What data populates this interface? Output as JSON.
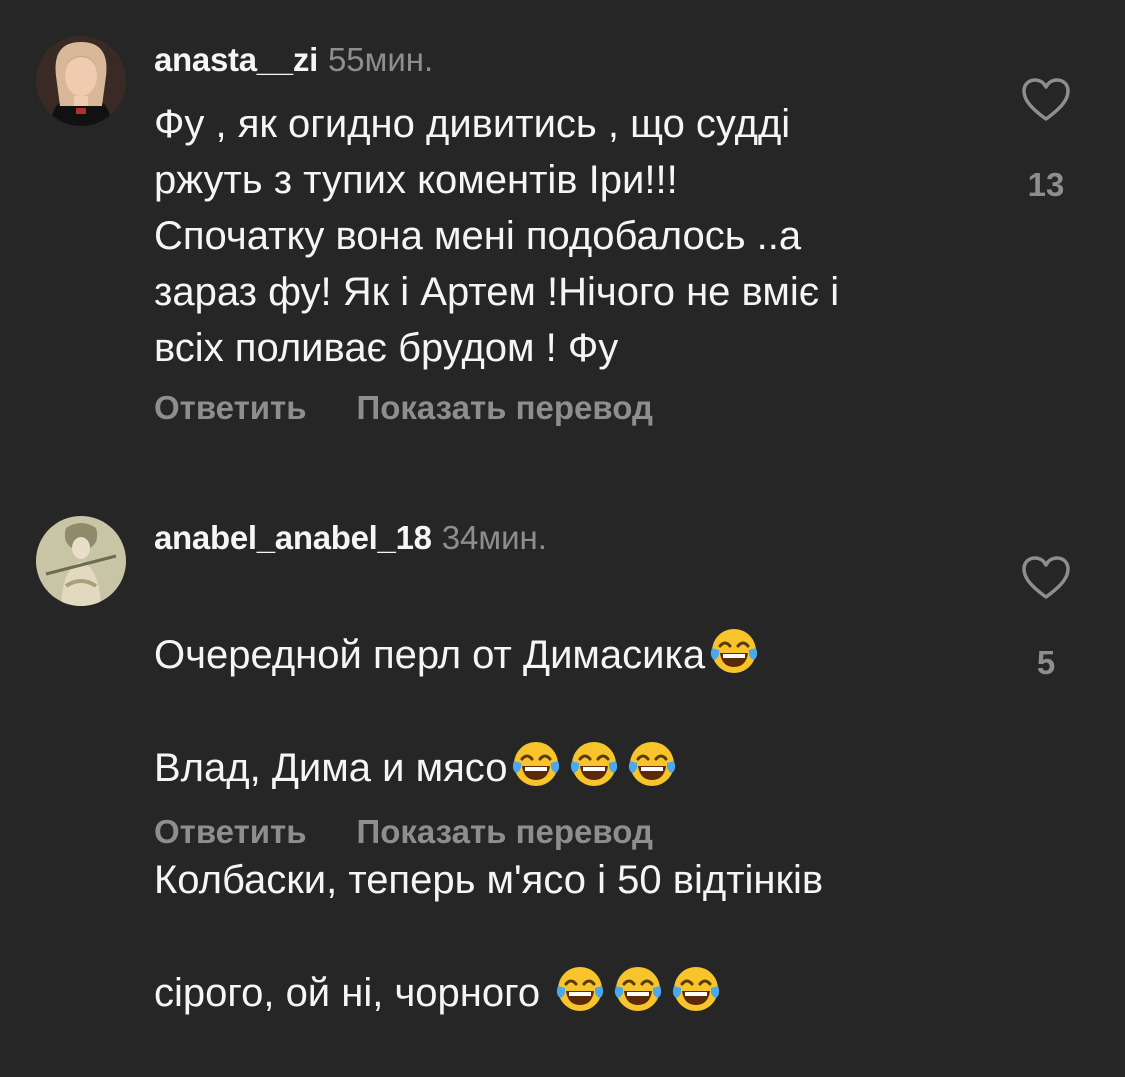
{
  "comments": [
    {
      "username": "anasta__zi",
      "time": "55мин.",
      "text": "Фу , як огидно  дивитись , що судді\nржуть з тупих коментів Іри!!!\nСпочатку вона мені подобалось ..а\nзараз фу! Як і Артем !Нічого не вміє і\nвсіх поливає брудом ! Фу",
      "reply_label": "Ответить",
      "translate_label": "Показать перевод",
      "like_count": "13",
      "avatar_icon": "user-avatar-photo"
    },
    {
      "username": "anabel_anabel_18",
      "time": "34мин.",
      "text_lines": [
        {
          "text": "Очередной перл от Димасика",
          "emoji_after": 1
        },
        {
          "text": "Влад, Дима и мясо",
          "emoji_after": 3
        },
        {
          "text": "Колбаски, теперь м'ясо і 50 відтінків",
          "emoji_after": 0
        },
        {
          "text": "сірого, ой ні, чорного ",
          "emoji_after": 3
        }
      ],
      "emoji_name": "face-with-tears-of-joy",
      "reply_label": "Ответить",
      "translate_label": "Показать перевод",
      "like_count": "5",
      "avatar_icon": "user-avatar-illustration"
    }
  ],
  "colors": {
    "background": "#262626",
    "primary_text": "#f5f5f5",
    "secondary_text": "#8e8e8e"
  }
}
